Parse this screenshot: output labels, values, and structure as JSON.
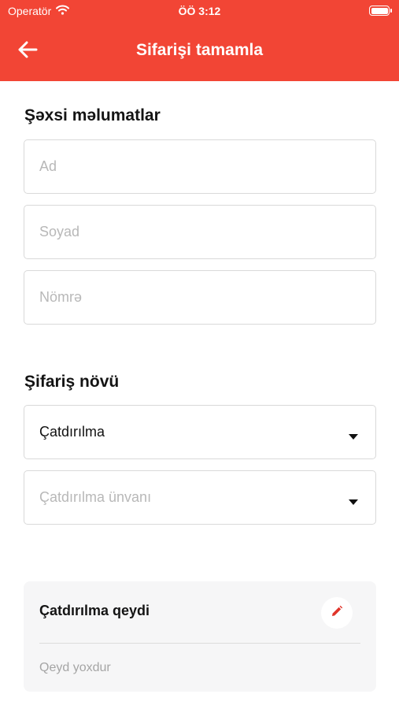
{
  "status_bar": {
    "carrier": "Operatör",
    "time": "ÖÖ 3:12"
  },
  "nav": {
    "title": "Sifarişi tamamla",
    "back_icon": "arrow-left-icon"
  },
  "personal": {
    "title": "Şəxsi məlumatlar",
    "first_name": {
      "placeholder": "Ad",
      "value": ""
    },
    "last_name": {
      "placeholder": "Soyad",
      "value": ""
    },
    "phone": {
      "placeholder": "Nömrə",
      "value": ""
    }
  },
  "order_type": {
    "title": "Şifariş növü",
    "type_select": {
      "value": "Çatdırılma"
    },
    "address_select": {
      "placeholder": "Çatdırılma ünvanı"
    }
  },
  "delivery_note": {
    "title": "Çatdırılma qeydi",
    "empty_text": "Qeyd yoxdur",
    "edit_icon": "pencil-icon"
  },
  "colors": {
    "accent": "#f24535",
    "border": "#d9d9d9",
    "card": "#f6f6f7"
  }
}
